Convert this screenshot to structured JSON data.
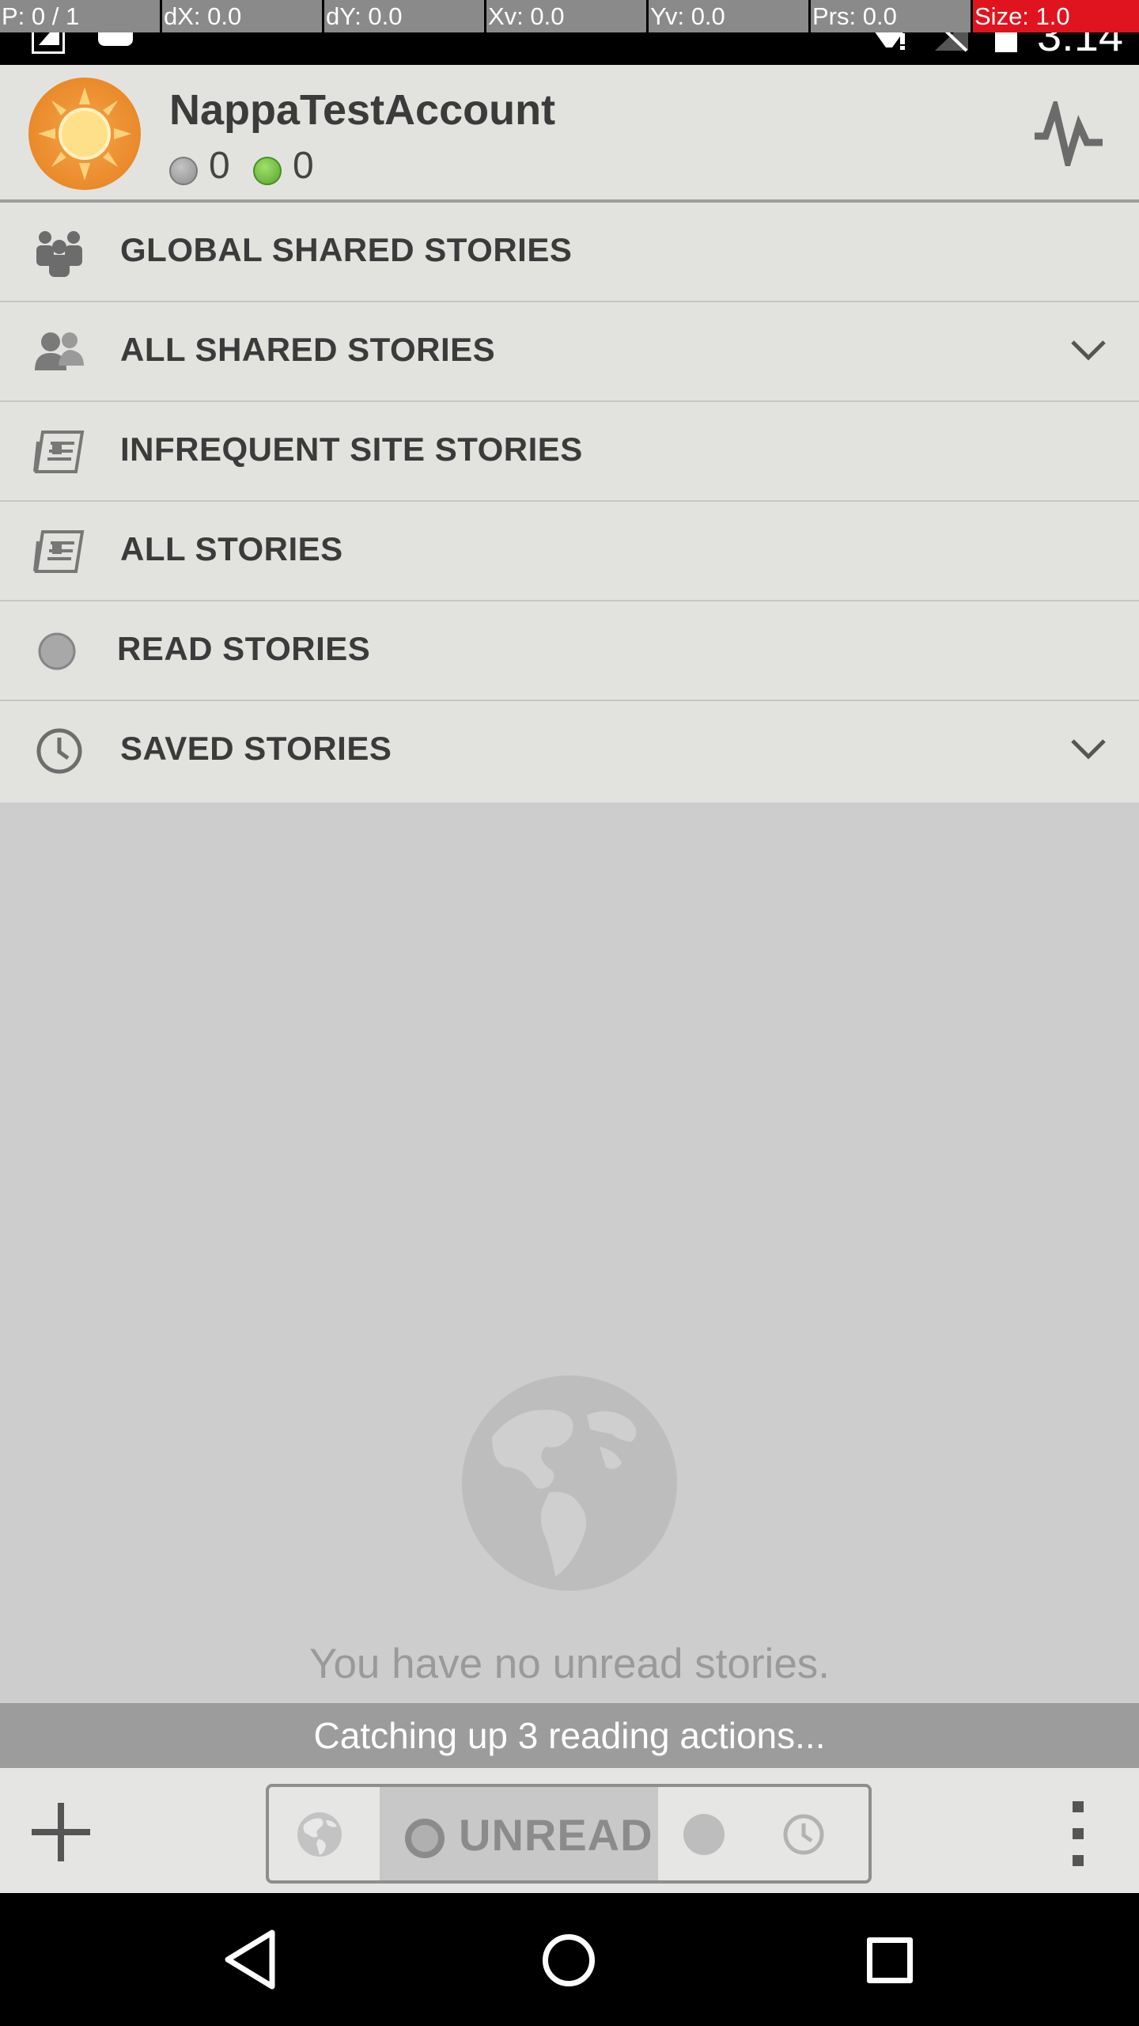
{
  "status_bar": {
    "pointer_overlay": [
      "P: 0 / 1",
      "dX: 0.0",
      "dY: 0.0",
      "Xv: 0.0",
      "Yv: 0.0",
      "Prs: 0.0",
      "Size: 1.0"
    ],
    "time": "3:14",
    "icons": [
      "notification-icon",
      "android-icon",
      "wifi-icon",
      "signal-icon",
      "battery-icon"
    ]
  },
  "account": {
    "name": "NappaTestAccount",
    "neutral_count": "0",
    "positive_count": "0",
    "colors": {
      "neutral": "#9a9a9a",
      "positive": "#6ab83a",
      "avatar": "#e98a2a"
    }
  },
  "folders": [
    {
      "label": "GLOBAL SHARED STORIES",
      "icon": "global-shared-icon",
      "expandable": false
    },
    {
      "label": "ALL SHARED STORIES",
      "icon": "shared-people-icon",
      "expandable": true
    },
    {
      "label": "INFREQUENT SITE STORIES",
      "icon": "newspaper-icon",
      "expandable": false
    },
    {
      "label": "ALL STORIES",
      "icon": "newspaper-icon",
      "expandable": false
    },
    {
      "label": "READ STORIES",
      "icon": "read-dot-icon",
      "expandable": false
    },
    {
      "label": "SAVED STORIES",
      "icon": "clock-icon",
      "expandable": true
    }
  ],
  "empty_state": {
    "message": "You have no unread stories.",
    "icon": "globe-icon"
  },
  "sync_banner": "Catching up 3 reading actions...",
  "toolbar": {
    "add_icon": "plus-icon",
    "filter": {
      "selected": "UNREAD",
      "segments": [
        "global-icon",
        "UNREAD",
        "read-dot-icon",
        "clock-icon"
      ]
    },
    "menu_icon": "overflow-menu-icon"
  },
  "nav_bar": {
    "icons": [
      "back-icon",
      "home-icon",
      "recents-icon"
    ]
  }
}
